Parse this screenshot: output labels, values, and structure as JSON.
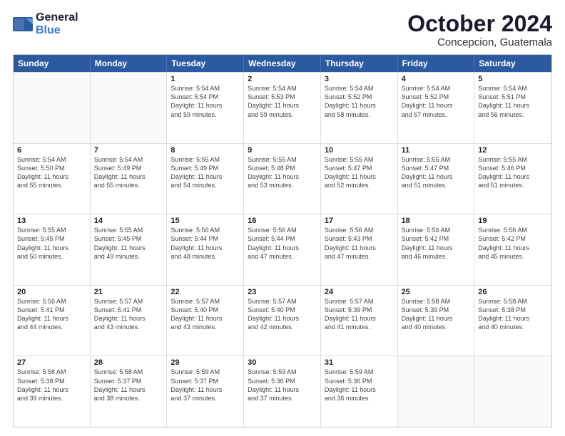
{
  "header": {
    "logo_general": "General",
    "logo_blue": "Blue",
    "month_title": "October 2024",
    "location": "Concepcion, Guatemala"
  },
  "weekdays": [
    "Sunday",
    "Monday",
    "Tuesday",
    "Wednesday",
    "Thursday",
    "Friday",
    "Saturday"
  ],
  "rows": [
    [
      {
        "day": "",
        "lines": []
      },
      {
        "day": "",
        "lines": []
      },
      {
        "day": "1",
        "lines": [
          "Sunrise: 5:54 AM",
          "Sunset: 5:54 PM",
          "Daylight: 11 hours",
          "and 59 minutes."
        ]
      },
      {
        "day": "2",
        "lines": [
          "Sunrise: 5:54 AM",
          "Sunset: 5:53 PM",
          "Daylight: 11 hours",
          "and 59 minutes."
        ]
      },
      {
        "day": "3",
        "lines": [
          "Sunrise: 5:54 AM",
          "Sunset: 5:52 PM",
          "Daylight: 11 hours",
          "and 58 minutes."
        ]
      },
      {
        "day": "4",
        "lines": [
          "Sunrise: 5:54 AM",
          "Sunset: 5:52 PM",
          "Daylight: 11 hours",
          "and 57 minutes."
        ]
      },
      {
        "day": "5",
        "lines": [
          "Sunrise: 5:54 AM",
          "Sunset: 5:51 PM",
          "Daylight: 11 hours",
          "and 56 minutes."
        ]
      }
    ],
    [
      {
        "day": "6",
        "lines": [
          "Sunrise: 5:54 AM",
          "Sunset: 5:50 PM",
          "Daylight: 11 hours",
          "and 55 minutes."
        ]
      },
      {
        "day": "7",
        "lines": [
          "Sunrise: 5:54 AM",
          "Sunset: 5:49 PM",
          "Daylight: 11 hours",
          "and 55 minutes."
        ]
      },
      {
        "day": "8",
        "lines": [
          "Sunrise: 5:55 AM",
          "Sunset: 5:49 PM",
          "Daylight: 11 hours",
          "and 54 minutes."
        ]
      },
      {
        "day": "9",
        "lines": [
          "Sunrise: 5:55 AM",
          "Sunset: 5:48 PM",
          "Daylight: 11 hours",
          "and 53 minutes."
        ]
      },
      {
        "day": "10",
        "lines": [
          "Sunrise: 5:55 AM",
          "Sunset: 5:47 PM",
          "Daylight: 11 hours",
          "and 52 minutes."
        ]
      },
      {
        "day": "11",
        "lines": [
          "Sunrise: 5:55 AM",
          "Sunset: 5:47 PM",
          "Daylight: 11 hours",
          "and 51 minutes."
        ]
      },
      {
        "day": "12",
        "lines": [
          "Sunrise: 5:55 AM",
          "Sunset: 5:46 PM",
          "Daylight: 11 hours",
          "and 51 minutes."
        ]
      }
    ],
    [
      {
        "day": "13",
        "lines": [
          "Sunrise: 5:55 AM",
          "Sunset: 5:45 PM",
          "Daylight: 11 hours",
          "and 50 minutes."
        ]
      },
      {
        "day": "14",
        "lines": [
          "Sunrise: 5:55 AM",
          "Sunset: 5:45 PM",
          "Daylight: 11 hours",
          "and 49 minutes."
        ]
      },
      {
        "day": "15",
        "lines": [
          "Sunrise: 5:56 AM",
          "Sunset: 5:44 PM",
          "Daylight: 11 hours",
          "and 48 minutes."
        ]
      },
      {
        "day": "16",
        "lines": [
          "Sunrise: 5:56 AM",
          "Sunset: 5:44 PM",
          "Daylight: 11 hours",
          "and 47 minutes."
        ]
      },
      {
        "day": "17",
        "lines": [
          "Sunrise: 5:56 AM",
          "Sunset: 5:43 PM",
          "Daylight: 11 hours",
          "and 47 minutes."
        ]
      },
      {
        "day": "18",
        "lines": [
          "Sunrise: 5:56 AM",
          "Sunset: 5:42 PM",
          "Daylight: 11 hours",
          "and 46 minutes."
        ]
      },
      {
        "day": "19",
        "lines": [
          "Sunrise: 5:56 AM",
          "Sunset: 5:42 PM",
          "Daylight: 11 hours",
          "and 45 minutes."
        ]
      }
    ],
    [
      {
        "day": "20",
        "lines": [
          "Sunrise: 5:56 AM",
          "Sunset: 5:41 PM",
          "Daylight: 11 hours",
          "and 44 minutes."
        ]
      },
      {
        "day": "21",
        "lines": [
          "Sunrise: 5:57 AM",
          "Sunset: 5:41 PM",
          "Daylight: 11 hours",
          "and 43 minutes."
        ]
      },
      {
        "day": "22",
        "lines": [
          "Sunrise: 5:57 AM",
          "Sunset: 5:40 PM",
          "Daylight: 11 hours",
          "and 43 minutes."
        ]
      },
      {
        "day": "23",
        "lines": [
          "Sunrise: 5:57 AM",
          "Sunset: 5:40 PM",
          "Daylight: 11 hours",
          "and 42 minutes."
        ]
      },
      {
        "day": "24",
        "lines": [
          "Sunrise: 5:57 AM",
          "Sunset: 5:39 PM",
          "Daylight: 11 hours",
          "and 41 minutes."
        ]
      },
      {
        "day": "25",
        "lines": [
          "Sunrise: 5:58 AM",
          "Sunset: 5:39 PM",
          "Daylight: 11 hours",
          "and 40 minutes."
        ]
      },
      {
        "day": "26",
        "lines": [
          "Sunrise: 5:58 AM",
          "Sunset: 5:38 PM",
          "Daylight: 11 hours",
          "and 40 minutes."
        ]
      }
    ],
    [
      {
        "day": "27",
        "lines": [
          "Sunrise: 5:58 AM",
          "Sunset: 5:38 PM",
          "Daylight: 11 hours",
          "and 39 minutes."
        ]
      },
      {
        "day": "28",
        "lines": [
          "Sunrise: 5:58 AM",
          "Sunset: 5:37 PM",
          "Daylight: 11 hours",
          "and 38 minutes."
        ]
      },
      {
        "day": "29",
        "lines": [
          "Sunrise: 5:59 AM",
          "Sunset: 5:37 PM",
          "Daylight: 11 hours",
          "and 37 minutes."
        ]
      },
      {
        "day": "30",
        "lines": [
          "Sunrise: 5:59 AM",
          "Sunset: 5:36 PM",
          "Daylight: 11 hours",
          "and 37 minutes."
        ]
      },
      {
        "day": "31",
        "lines": [
          "Sunrise: 5:59 AM",
          "Sunset: 5:36 PM",
          "Daylight: 11 hours",
          "and 36 minutes."
        ]
      },
      {
        "day": "",
        "lines": []
      },
      {
        "day": "",
        "lines": []
      }
    ]
  ]
}
